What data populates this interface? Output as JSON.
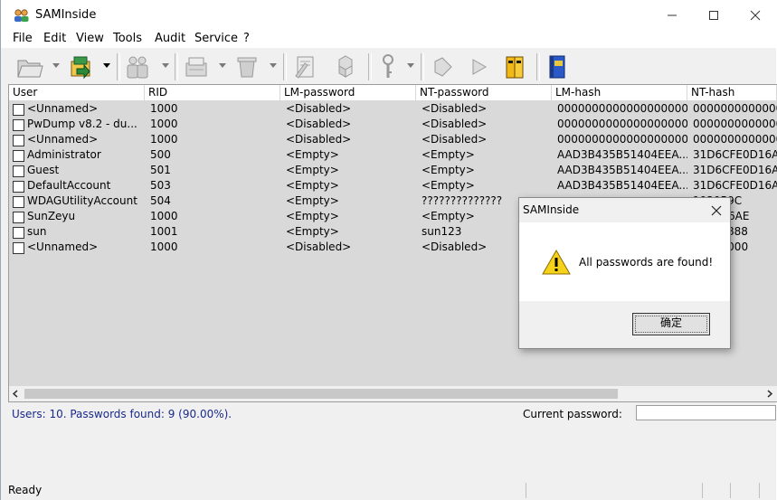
{
  "window": {
    "title": "SAMInside",
    "icon": "users-icon"
  },
  "menu": [
    "File",
    "Edit",
    "View",
    "Tools",
    "Audit",
    "Service",
    "?"
  ],
  "toolbar_icons": [
    "open-folder-icon",
    "import-icon",
    "users-icon",
    "save-icon",
    "delete-icon",
    "properties-icon",
    "cubes-icon",
    "key-icon",
    "prev-icon",
    "next-icon",
    "books-icon",
    "help-book-icon"
  ],
  "columns": [
    "User",
    "RID",
    "LM-password",
    "NT-password",
    "LM-hash",
    "NT-hash"
  ],
  "rows": [
    {
      "user": "<Unnamed>",
      "rid": "1000",
      "lm_pw": "<Disabled>",
      "nt_pw": "<Disabled>",
      "lm_hash": "0000000000000000000...",
      "nt_hash": "00000000000000"
    },
    {
      "user": "PwDump v8.2 - du...",
      "rid": "1000",
      "lm_pw": "<Disabled>",
      "nt_pw": "<Disabled>",
      "lm_hash": "0000000000000000000...",
      "nt_hash": "00000000000000"
    },
    {
      "user": "<Unnamed>",
      "rid": "1000",
      "lm_pw": "<Disabled>",
      "nt_pw": "<Disabled>",
      "lm_hash": "0000000000000000000...",
      "nt_hash": "00000000000000"
    },
    {
      "user": "Administrator",
      "rid": "500",
      "lm_pw": "<Empty>",
      "nt_pw": "<Empty>",
      "lm_hash": "AAD3B435B51404EEA...",
      "nt_hash": "31D6CFE0D16AE"
    },
    {
      "user": "Guest",
      "rid": "501",
      "lm_pw": "<Empty>",
      "nt_pw": "<Empty>",
      "lm_hash": "AAD3B435B51404EEA...",
      "nt_hash": "31D6CFE0D16AE"
    },
    {
      "user": "DefaultAccount",
      "rid": "503",
      "lm_pw": "<Empty>",
      "nt_pw": "<Empty>",
      "lm_hash": "AAD3B435B51404EEA...",
      "nt_hash": "31D6CFE0D16AE"
    },
    {
      "user": "WDAGUtilityAccount",
      "rid": "504",
      "lm_pw": "<Empty>",
      "nt_pw": "??????????????",
      "lm_hash": "",
      "nt_hash": "193059C"
    },
    {
      "user": "SunZeyu",
      "rid": "1000",
      "lm_pw": "<Empty>",
      "nt_pw": "<Empty>",
      "lm_hash": "",
      "nt_hash": "FE0D16AE"
    },
    {
      "user": "sun",
      "rid": "1001",
      "lm_pw": "<Empty>",
      "nt_pw": "sun123",
      "lm_hash": "",
      "nt_hash": "2F7A9888"
    },
    {
      "user": "<Unnamed>",
      "rid": "1000",
      "lm_pw": "<Disabled>",
      "nt_pw": "<Disabled>",
      "lm_hash": "",
      "nt_hash": "00000000"
    }
  ],
  "status": {
    "summary": "Users: 10. Passwords found: 9 (90.00%).",
    "current_password_label": "Current password:",
    "current_password_value": "",
    "ready": "Ready"
  },
  "dialog": {
    "title": "SAMInside",
    "message": "All passwords are found!",
    "ok_label": "确定",
    "icon": "warning-icon"
  },
  "colors": {
    "summary_text": "#1a2a8a",
    "rows_bg": "#d9d9d9"
  }
}
